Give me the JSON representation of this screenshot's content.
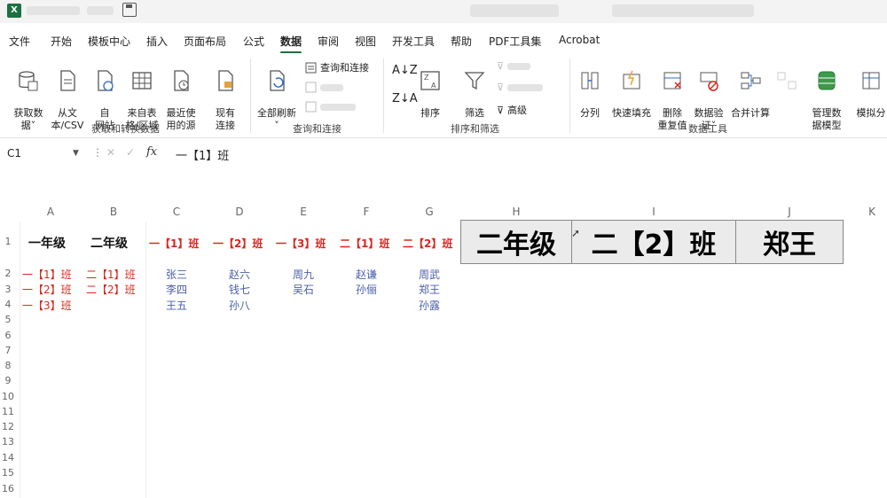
{
  "tabs": [
    "文件",
    "开始",
    "模板中心",
    "插入",
    "页面布局",
    "公式",
    "数据",
    "审阅",
    "视图",
    "开发工具",
    "帮助",
    "PDF工具集",
    "Acrobat"
  ],
  "active_tab": "数据",
  "ribbon": {
    "get_data": "获取数\n据˅",
    "from_csv": "从文\n本/CSV",
    "from_web": "自\n网站",
    "from_table": "来自表\n格/区域",
    "recent_sources": "最近使\n用的源",
    "existing_conn": "现有\n连接",
    "refresh_all": "全部刷新\n˅",
    "queries_conn": "查询和连接",
    "sort": "排序",
    "filter": "筛选",
    "advanced": "高级",
    "split": "分列",
    "flash_fill": "快速填充",
    "remove_dup": "删除\n重复值",
    "validation": "数据验\n证˅",
    "consolidate": "合并计算",
    "data_model": "管理数\n据模型",
    "whatif": "模拟分",
    "group_get": "获取和转换数据",
    "group_query": "查询和连接",
    "group_sort": "排序和筛选",
    "group_tools": "数据工具"
  },
  "formula_bar": {
    "name_box": "C1",
    "fx": "fx",
    "formula": "一【1】班"
  },
  "columns": [
    "A",
    "B",
    "C",
    "D",
    "E",
    "F",
    "G",
    "H",
    "I",
    "J",
    "K"
  ],
  "rows": [
    "1",
    "2",
    "3",
    "4",
    "5",
    "6",
    "7",
    "8",
    "9",
    "10",
    "11",
    "12",
    "13",
    "14",
    "15",
    "16"
  ],
  "cells": {
    "a1": "一年级",
    "b1": "二年级",
    "c1": "一【1】班",
    "d1": "一【2】班",
    "e1": "一【3】班",
    "f1": "二【1】班",
    "g1": "二【2】班",
    "a2": "一【1】班",
    "a3": "一【2】班",
    "a4": "一【3】班",
    "b2": "二【1】班",
    "b3": "二【2】班",
    "c2": "张三",
    "c3": "李四",
    "c4": "王五",
    "d2": "赵六",
    "d3": "钱七",
    "d4": "孙八",
    "e2": "周九",
    "e3": "吴石",
    "f2": "赵谦",
    "f3": "孙俪",
    "g2": "周武",
    "g3": "郑王",
    "g4": "孙露"
  },
  "overlay": [
    "二年级",
    "二【2】班",
    "郑王"
  ]
}
